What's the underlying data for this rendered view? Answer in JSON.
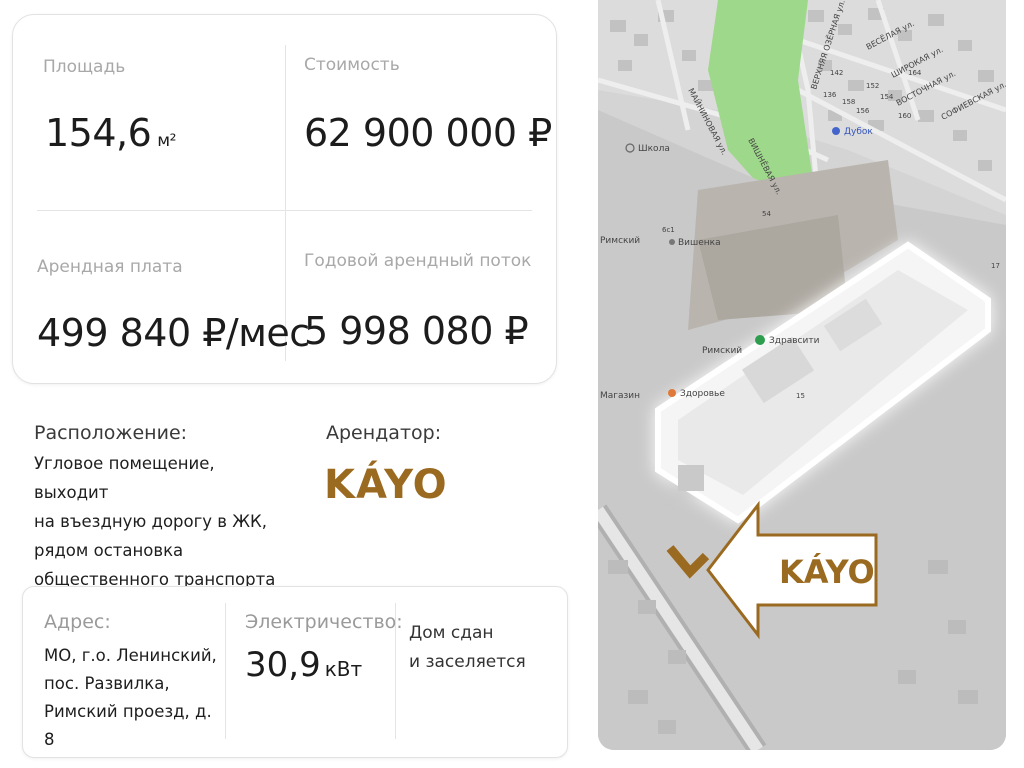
{
  "stats": {
    "area_label": "Площадь",
    "area_value": "154,6",
    "area_unit": "м²",
    "cost_label": "Стоимость",
    "cost_value": "62 900 000 ₽",
    "rent_label": "Арендная плата",
    "rent_value": "499 840 ₽/мес",
    "annual_label": "Годовой арендный поток",
    "annual_value": "5 998 080 ₽"
  },
  "location": {
    "title": "Расположение:",
    "lines": [
      "Угловое помещение, выходит",
      "на въездную дорогу в ЖК,",
      "рядом остановка",
      "общественного транспорта"
    ]
  },
  "tenant": {
    "title": "Арендатор:",
    "logo_text": "KÁYO",
    "brand_color": "#9b6a21"
  },
  "info": {
    "address_label": "Адрес:",
    "address_lines": [
      "МО, г.о. Ленинский,",
      "пос. Развилка,",
      "Римский проезд, д. 8"
    ],
    "electricity_label": "Электричество:",
    "electricity_value": "30,9",
    "electricity_unit": "кВт",
    "status_lines": [
      "Дом сдан",
      "и заселяется"
    ]
  },
  "map": {
    "street_labels": [
      "ВЕРХНЯЯ ОЗЁРНАЯ ул.",
      "ВЕСЁЛАЯ ул.",
      "ШИРОКАЯ ул.",
      "ВОСТОЧНАЯ ул.",
      "СОФИЕВСКАЯ ул.",
      "МАЙНИНОВАЯ ул.",
      "ВИШНЁВАЯ ул."
    ],
    "poi_school": "Школа",
    "poi_dubok": "Дубок",
    "poi_vishenka": "Вишенка",
    "poi_zdravsiti": "Здравсити",
    "poi_rimsky_1": "Римский",
    "poi_rimsky_2": "Римский",
    "poi_magazin": "Магазин",
    "poi_zdorovie": "Здоровье",
    "callout_label": "KÁYO",
    "house_numbers": [
      "17",
      "15",
      "54",
      "6с1",
      "152",
      "154",
      "156",
      "158",
      "160",
      "136",
      "142",
      "164"
    ]
  }
}
